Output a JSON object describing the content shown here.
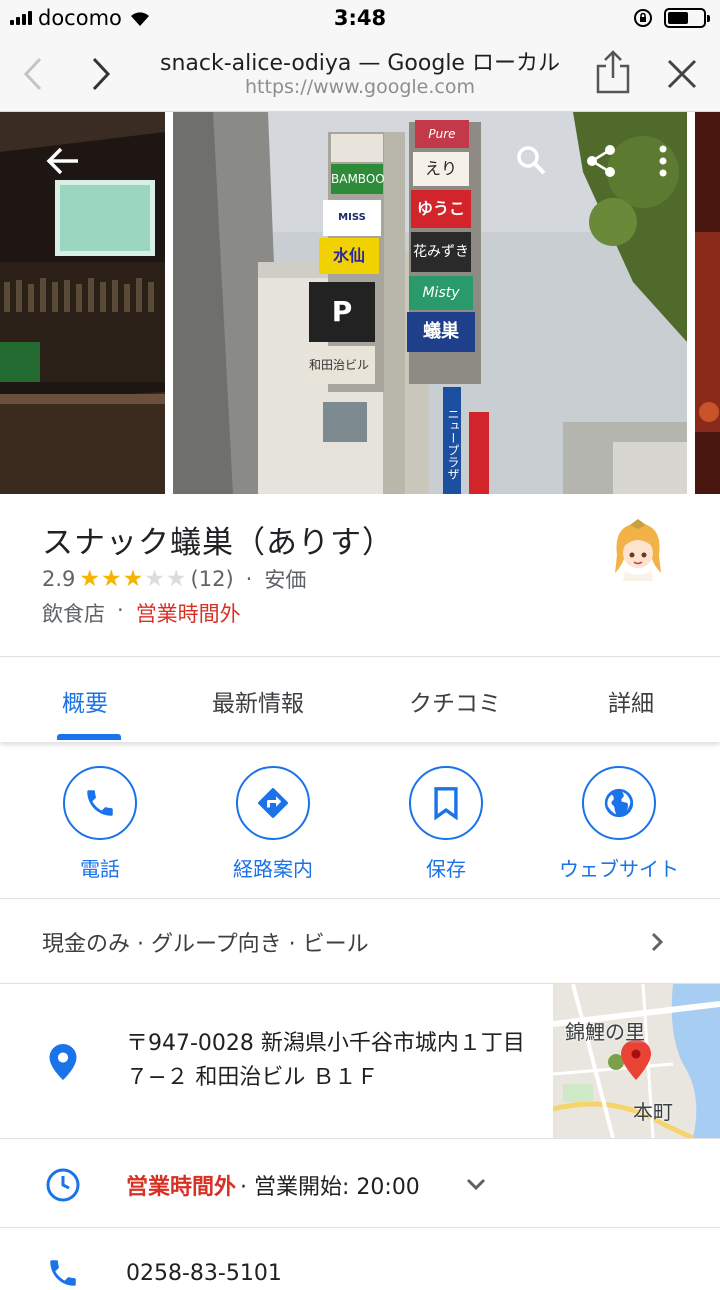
{
  "status_bar": {
    "carrier": "docomo",
    "time": "3:48",
    "battery_level": 0.6
  },
  "browser": {
    "title": "snack-alice-odiya — Google ローカル",
    "url": "https://www.google.com"
  },
  "photo_signs": {
    "left_column": [
      "BAMBOO",
      "MISS SAIGON",
      "水仙",
      "P",
      "和田治ビル"
    ],
    "right_column": [
      "Pure",
      "えり",
      "ゆうこ",
      "花みずき",
      "Misty",
      "蟻巣"
    ],
    "vertical": "ニュープラザ"
  },
  "place": {
    "name": "スナック蟻巣（ありす）",
    "rating": "2.9",
    "stars_filled": 3,
    "stars_total": 5,
    "review_count": "(12)",
    "separator": "·",
    "price": "安価",
    "category": "飲食店",
    "open_status": "営業時間外"
  },
  "tabs": [
    {
      "label": "概要",
      "active": true
    },
    {
      "label": "最新情報",
      "active": false
    },
    {
      "label": "クチコミ",
      "active": false
    },
    {
      "label": "詳細",
      "active": false
    }
  ],
  "actions": [
    {
      "label": "電話",
      "icon": "phone-icon"
    },
    {
      "label": "経路案内",
      "icon": "directions-icon"
    },
    {
      "label": "保存",
      "icon": "bookmark-icon"
    },
    {
      "label": "ウェブサイト",
      "icon": "globe-icon"
    }
  ],
  "attributes": "現金のみ · グループ向き · ビール",
  "address": "〒947-0028 新潟県小千谷市城内１丁目７−２ 和田治ビル Ｂ１Ｆ",
  "map": {
    "label_top": "錦鯉の里",
    "label_bottom": "本町"
  },
  "hours": {
    "status": "営業時間外",
    "detail": "· 営業開始: 20:00"
  },
  "phone": "0258-83-5101",
  "colors": {
    "accent": "#1a73e8",
    "closed": "#d93025",
    "star": "#f4b400"
  }
}
